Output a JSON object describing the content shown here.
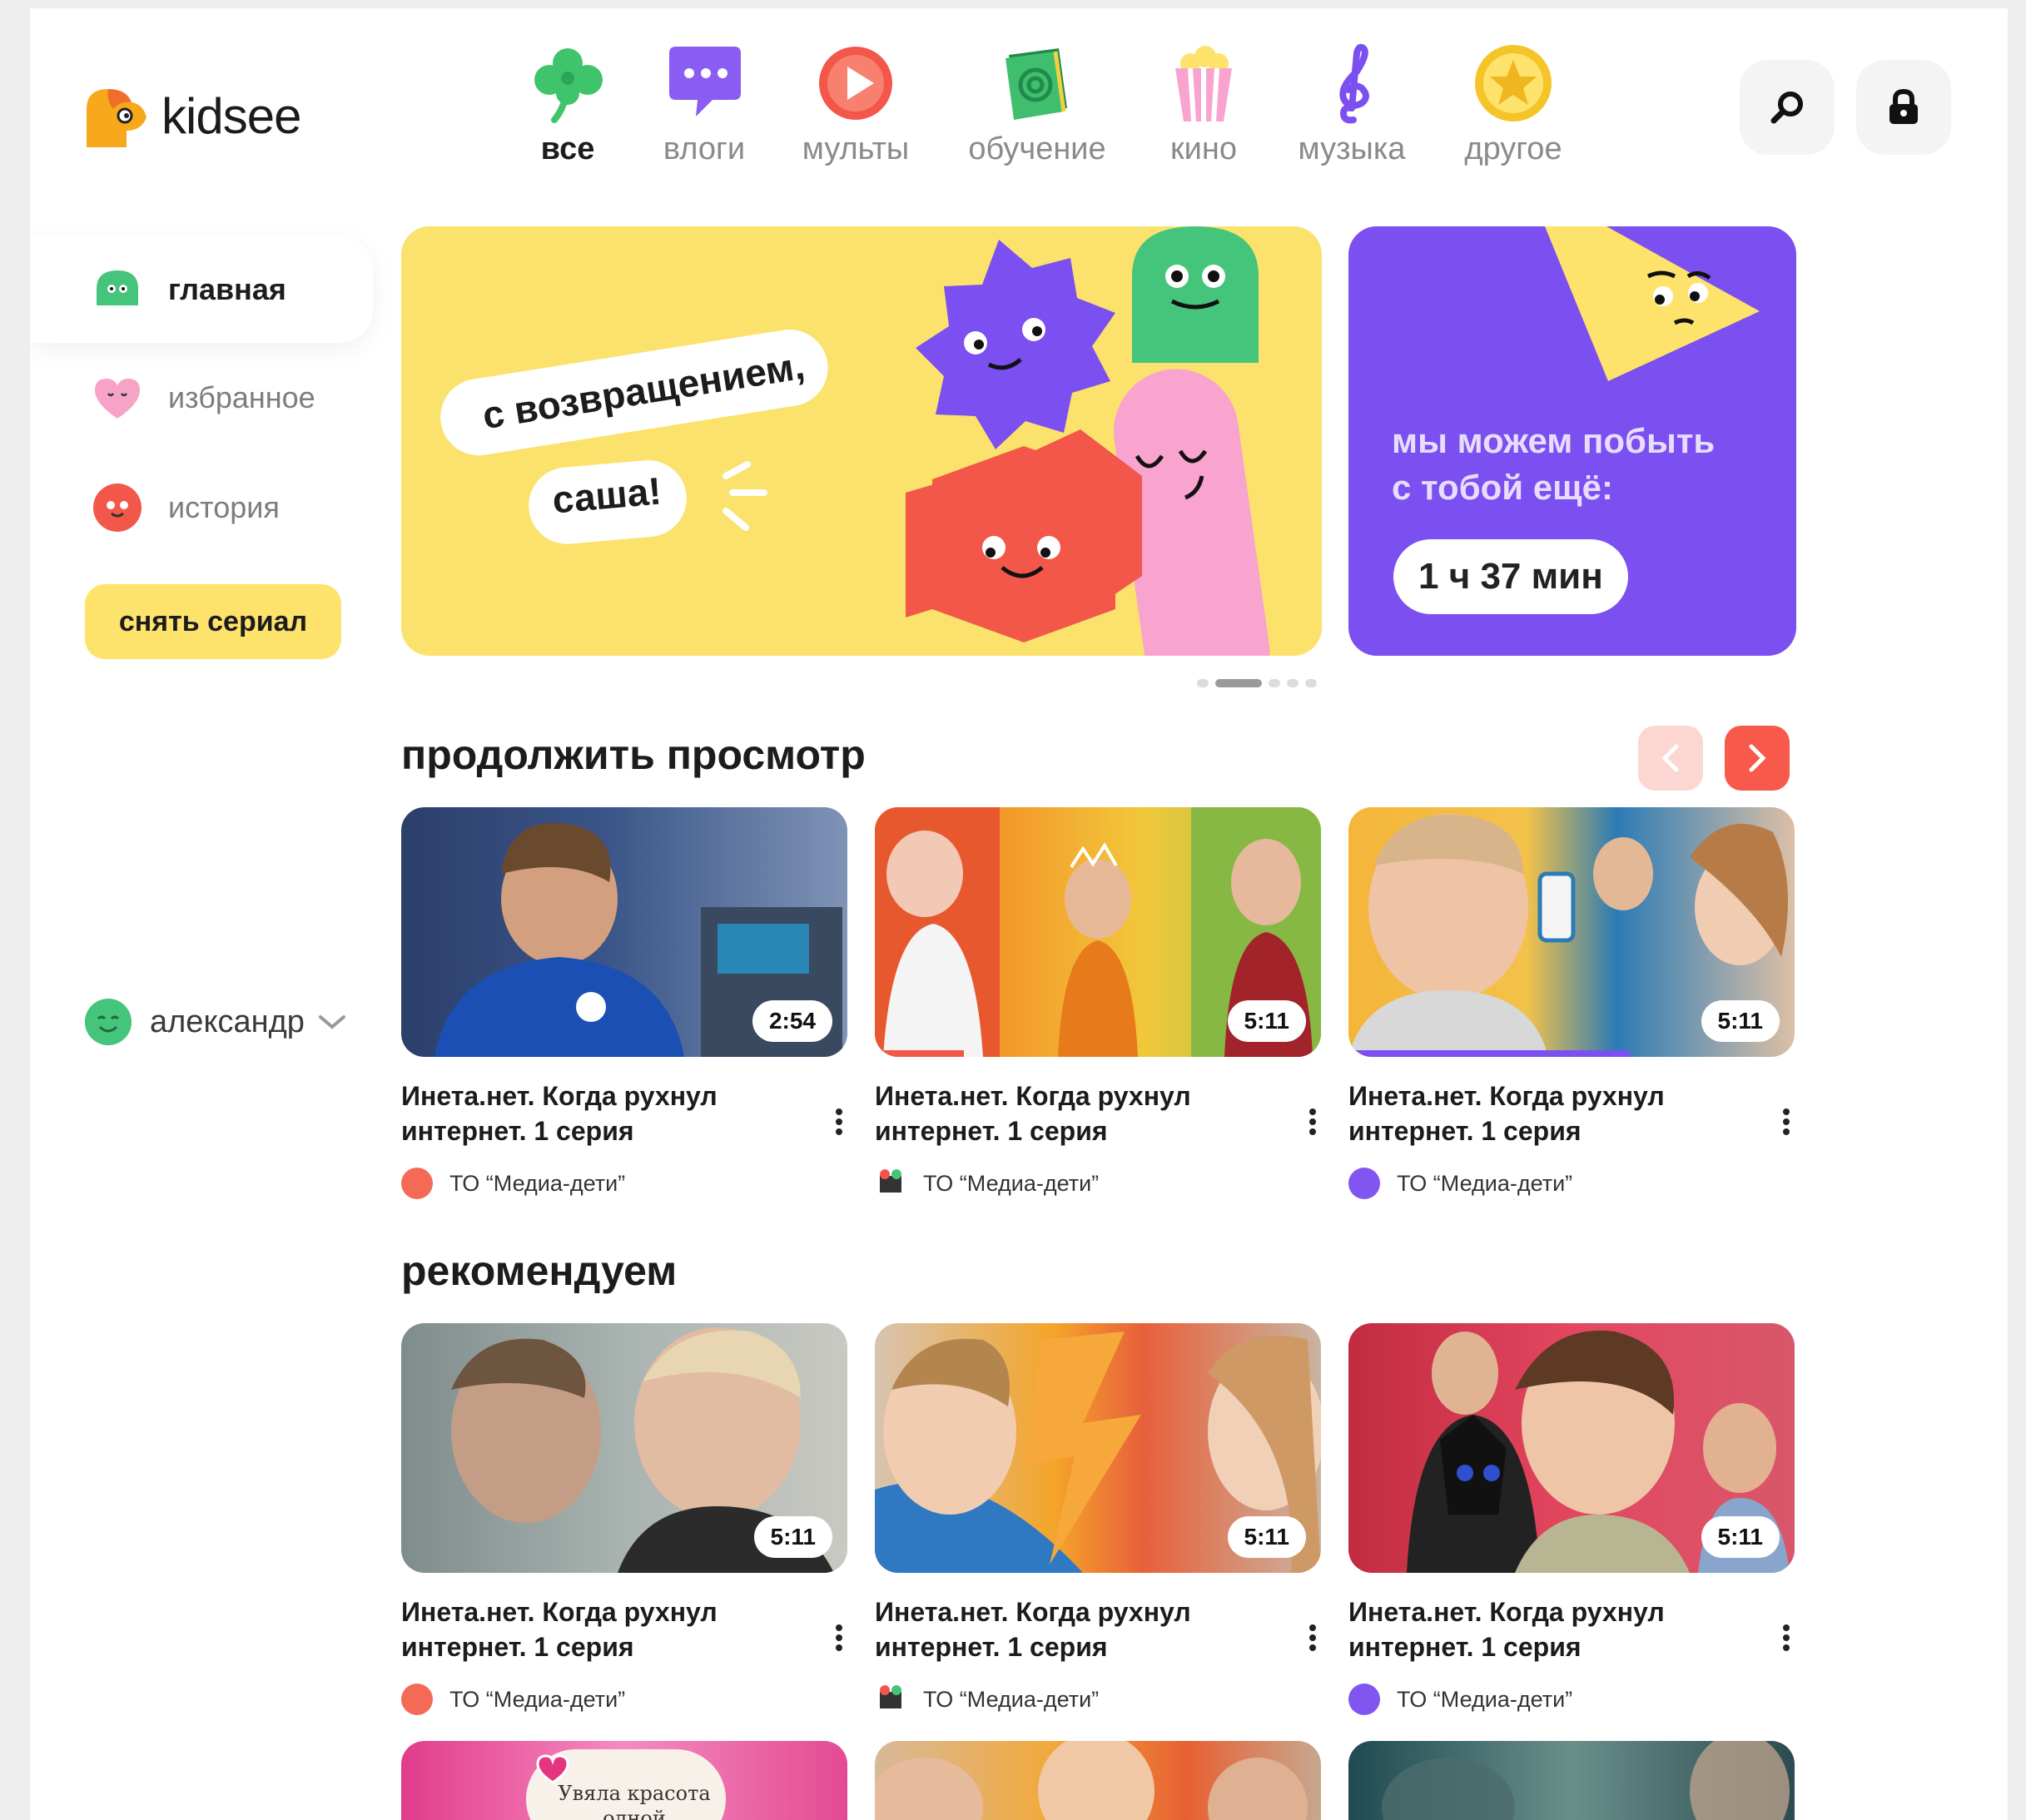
{
  "app": {
    "brand": "kidsee"
  },
  "categories": [
    {
      "id": "all",
      "label": "все",
      "icon": "clover-icon",
      "active": true
    },
    {
      "id": "vlogs",
      "label": "влоги",
      "icon": "chat-bubble-icon",
      "active": false
    },
    {
      "id": "cartoons",
      "label": "мульты",
      "icon": "play-icon",
      "active": false
    },
    {
      "id": "learning",
      "label": "обучение",
      "icon": "book-icon",
      "active": false
    },
    {
      "id": "cinema",
      "label": "кино",
      "icon": "popcorn-icon",
      "active": false
    },
    {
      "id": "music",
      "label": "музыка",
      "icon": "treble-clef-icon",
      "active": false
    },
    {
      "id": "other",
      "label": "другое",
      "icon": "star-coin-icon",
      "active": false
    }
  ],
  "header_buttons": {
    "search": "search-icon",
    "lock": "lock-icon"
  },
  "sidebar": {
    "items": [
      {
        "label": "главная",
        "icon": "green-face-icon",
        "active": true
      },
      {
        "label": "избранное",
        "icon": "heart-face-icon",
        "active": false
      },
      {
        "label": "история",
        "icon": "red-face-icon",
        "active": false
      }
    ],
    "cta_label": "снять сериал",
    "user_name": "александр"
  },
  "banner": {
    "greeting_line1": "с возвращением,",
    "greeting_line2": "саша!",
    "time_line1": "мы можем побыть",
    "time_line2": "с тобой ещё:",
    "time_value": "1 ч 37 мин"
  },
  "sections": {
    "continue_title": "продолжить просмотр",
    "recommend_title": "рекомендуем"
  },
  "continue_cards": [
    {
      "title": "Инета.нет. Когда рухнул интернет. 1 серия",
      "duration": "2:54",
      "channel": "ТО “Медиа-дети”",
      "progress": 0
    },
    {
      "title": "Инета.нет. Когда рухнул интернет. 1 серия",
      "duration": "5:11",
      "channel": "ТО “Медиа-дети”",
      "progress": 0.2
    },
    {
      "title": "Инета.нет. Когда рухнул интернет. 1 серия",
      "duration": "5:11",
      "channel": "ТО “Медиа-дети”",
      "progress": 0.63
    }
  ],
  "recommend_cards": [
    {
      "title": "Инета.нет. Когда рухнул интернет. 1 серия",
      "duration": "5:11",
      "channel": "ТО “Медиа-дети”"
    },
    {
      "title": "Инета.нет. Когда рухнул интернет. 1 серия",
      "duration": "5:11",
      "channel": "ТО “Медиа-дети”"
    },
    {
      "title": "Инета.нет. Когда рухнул интернет. 1 серия",
      "duration": "5:11",
      "channel": "ТО “Медиа-дети”"
    }
  ],
  "bottom_thumb_text": "Увяла красота одной",
  "colors": {
    "accent_yellow": "#fde36b",
    "banner_purple": "#7b4ff0",
    "arrow_red": "#f7594a",
    "channel_red": "#f56a56",
    "channel_purple": "#8155ef"
  }
}
